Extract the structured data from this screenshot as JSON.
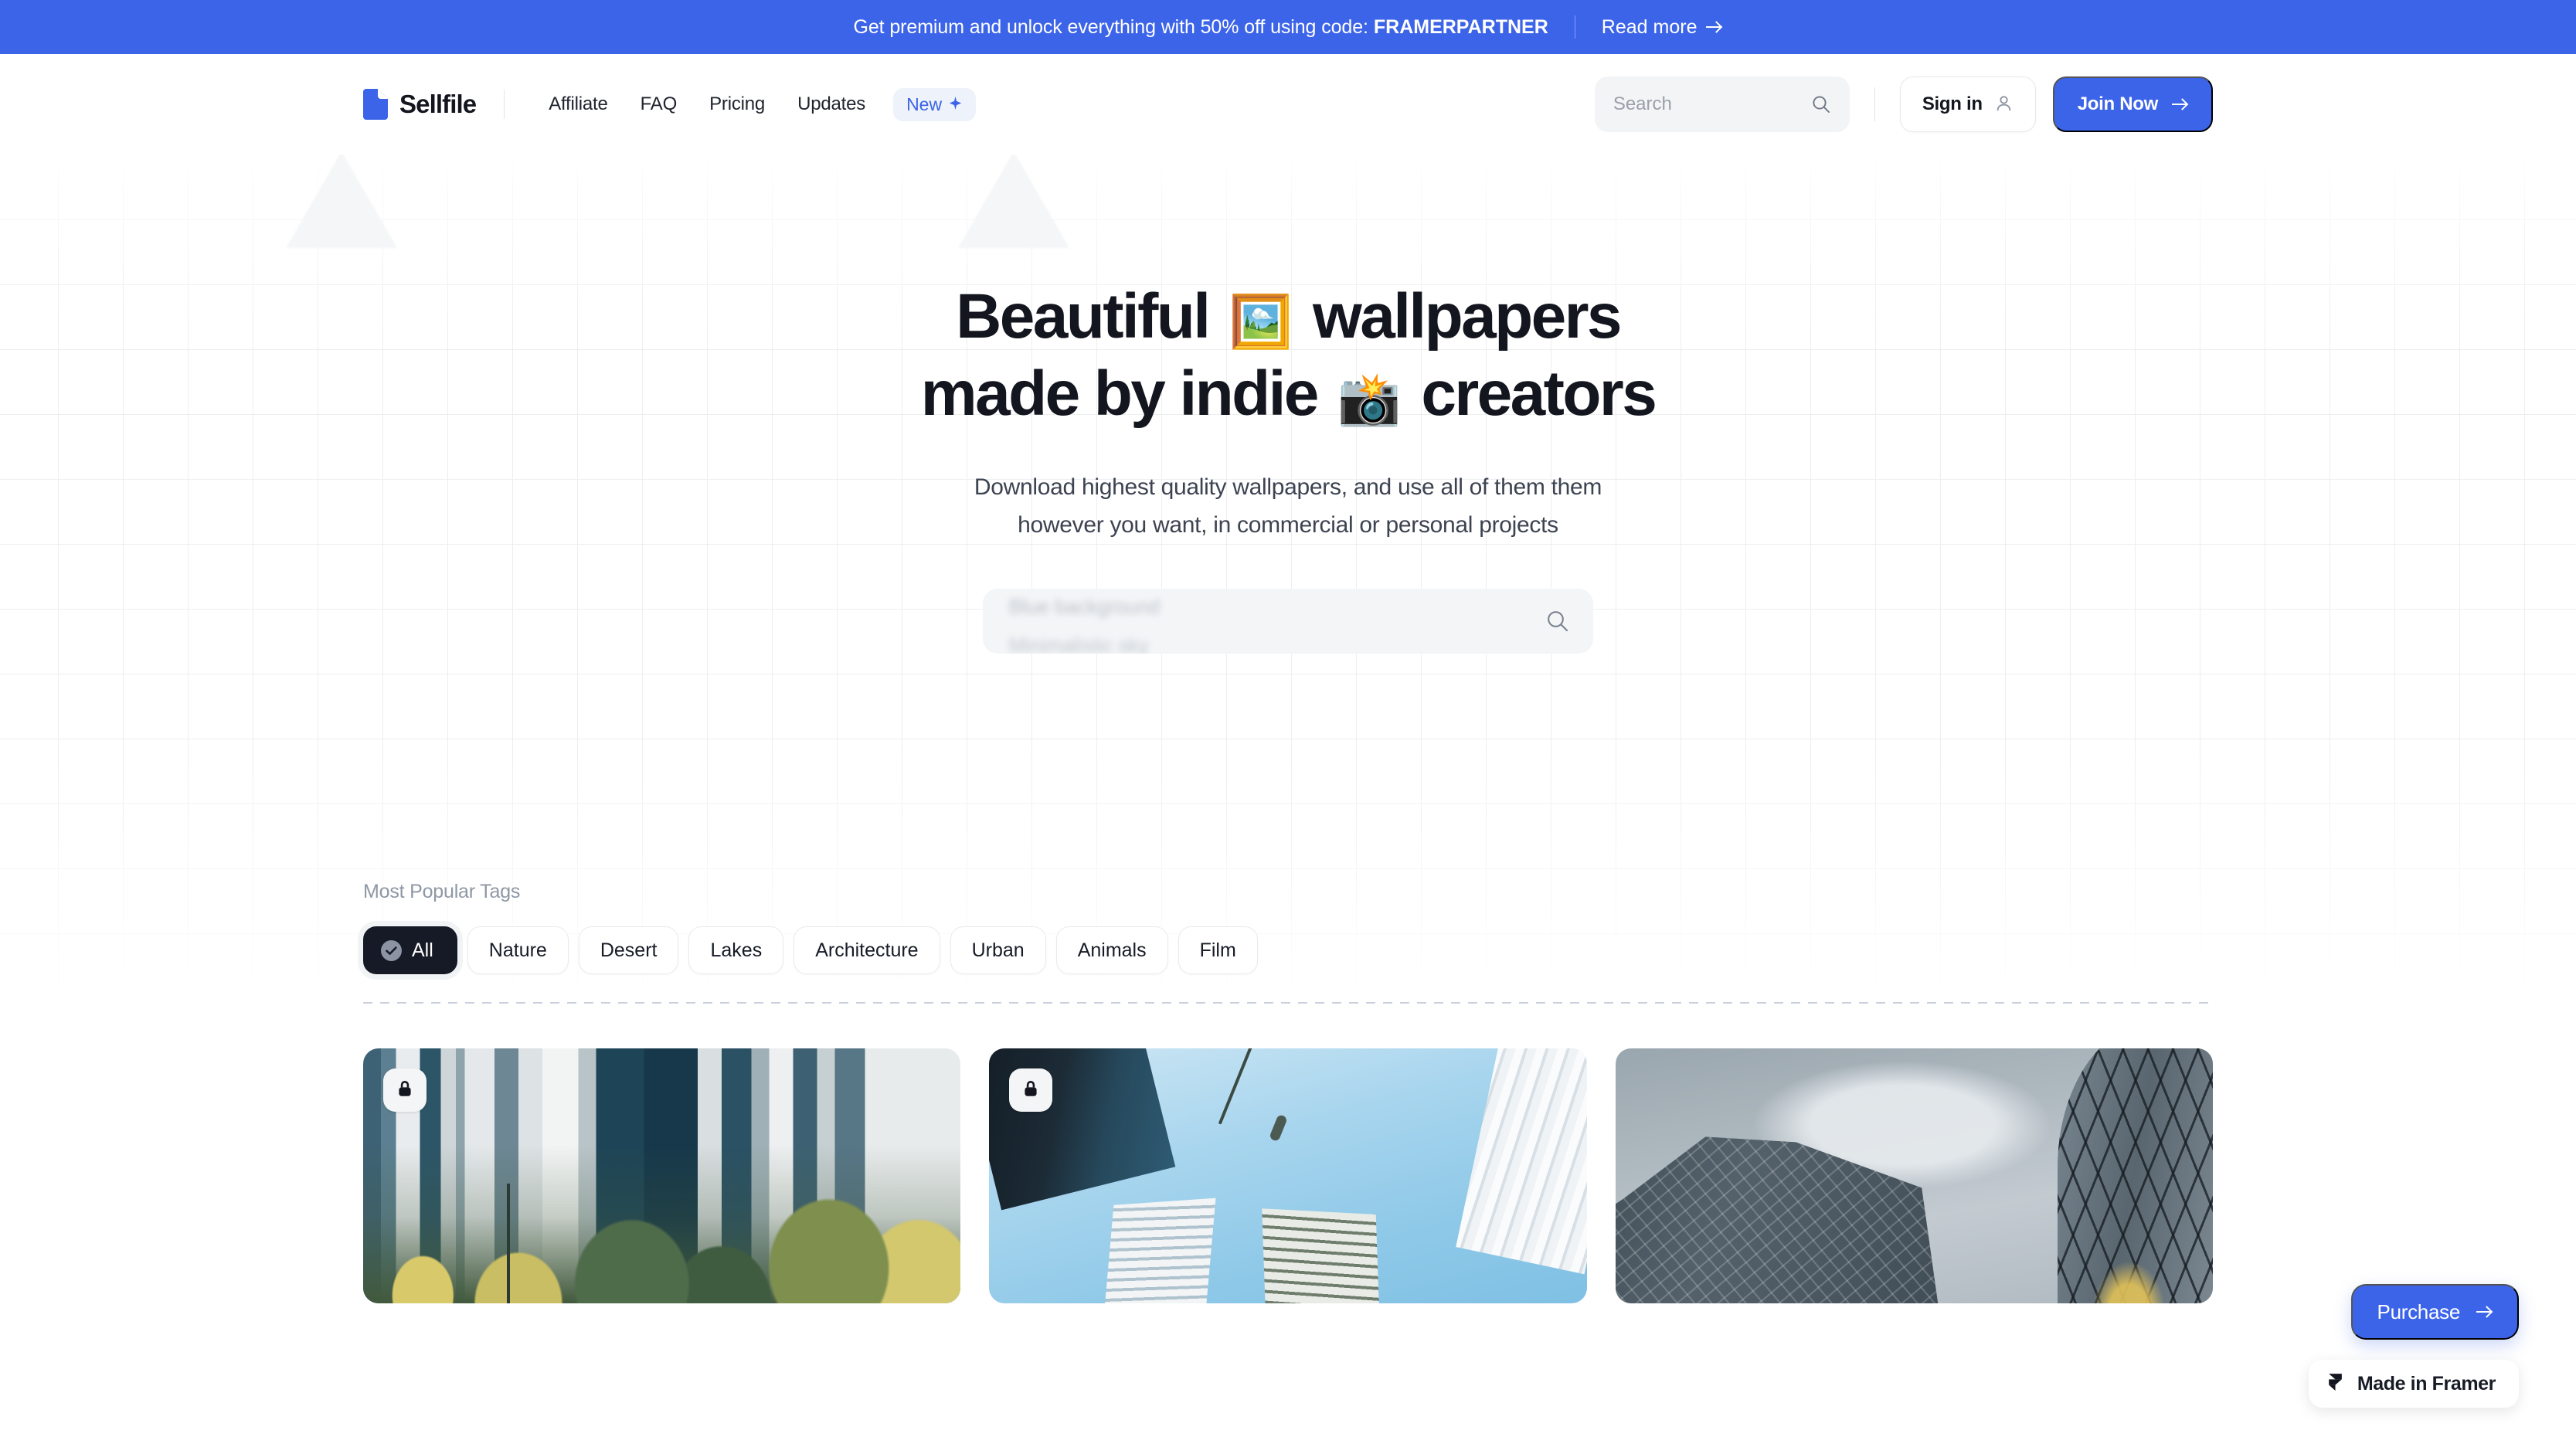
{
  "promo_banner": {
    "text": "Get premium and unlock everything with 50% off using code:",
    "code": "FRAMERPARTNER",
    "read_more": "Read more",
    "arrow_icon": "arrow-right-icon",
    "background_color": "#3C64E8",
    "text_color": "#FFFFFF"
  },
  "navbar": {
    "logo_icon": "sellfile-file-logo-icon",
    "brand": "Sellfile",
    "links": [
      {
        "label": "Affiliate"
      },
      {
        "label": "FAQ"
      },
      {
        "label": "Pricing"
      },
      {
        "label": "Updates"
      }
    ],
    "new_badge": {
      "label": "New",
      "icon": "sparkle-icon",
      "text_color": "#3C64E8",
      "background_color": "#EEF2FA"
    },
    "search": {
      "placeholder": "Search",
      "icon": "search-icon"
    },
    "sign_in": {
      "label": "Sign in",
      "icon": "user-icon"
    },
    "join_now": {
      "label": "Join Now",
      "icon": "arrow-right-icon",
      "background_color": "#3C64E8"
    }
  },
  "hero": {
    "title_line1_before": "Beautiful",
    "title_emoji1": "🖼️",
    "title_line1_after": "wallpapers",
    "title_line2_before": "made by indie",
    "title_emoji2": "📸",
    "title_line2_after": "creators",
    "subtitle_line1": "Download highest quality wallpapers, and use all of them them",
    "subtitle_line2": "however you want, in commercial or personal projects",
    "search": {
      "placeholder_rotating_1": "Blue background",
      "placeholder_rotating_2": "Minimalistic sky",
      "icon": "search-icon"
    }
  },
  "tags": {
    "label": "Most Popular Tags",
    "items": [
      {
        "label": "All",
        "active": true,
        "icon": "check-circle-icon"
      },
      {
        "label": "Nature",
        "active": false
      },
      {
        "label": "Desert",
        "active": false
      },
      {
        "label": "Lakes",
        "active": false
      },
      {
        "label": "Architecture",
        "active": false
      },
      {
        "label": "Urban",
        "active": false
      },
      {
        "label": "Animals",
        "active": false
      },
      {
        "label": "Film",
        "active": false
      }
    ]
  },
  "cards": [
    {
      "name": "city-park-skyline-wallpaper",
      "locked": true,
      "lock_icon": "lock-icon"
    },
    {
      "name": "looking-up-buildings-blue-sky-wallpaper",
      "locked": true,
      "lock_icon": "lock-icon"
    },
    {
      "name": "glass-skyscrapers-grey-sky-wallpaper",
      "locked": false,
      "lock_icon": "lock-icon"
    }
  ],
  "floating": {
    "purchase": {
      "label": "Purchase",
      "icon": "arrow-right-icon",
      "background_color": "#3C64E8"
    },
    "framer_badge": {
      "label": "Made in Framer",
      "icon": "framer-logo-icon"
    }
  }
}
